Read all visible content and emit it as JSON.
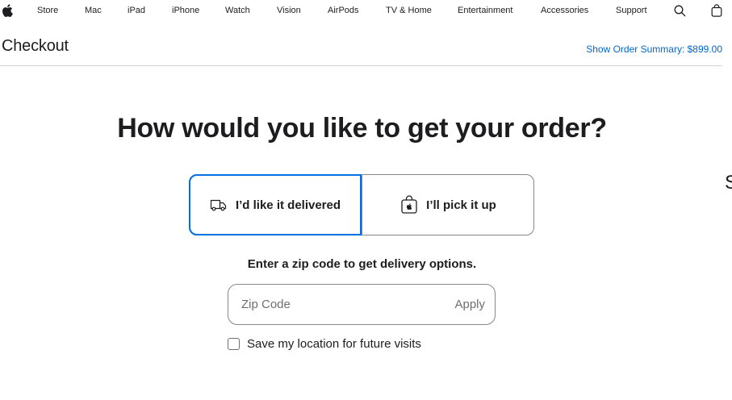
{
  "globalnav": {
    "items": [
      "Store",
      "Mac",
      "iPad",
      "iPhone",
      "Watch",
      "Vision",
      "AirPods",
      "TV & Home",
      "Entertainment",
      "Accessories",
      "Support"
    ]
  },
  "header": {
    "title": "Checkout",
    "order_summary": "Show Order Summary: $899.00"
  },
  "main": {
    "heading": "How would you like to get your order?",
    "options": {
      "delivered": "I’d like it delivered",
      "pickup": "I’ll pick it up"
    },
    "zip_prompt": "Enter a zip code to get delivery options.",
    "zip_placeholder": "Zip Code",
    "apply_label": "Apply",
    "save_location_label": "Save my location for future visits"
  },
  "edge_text": "S",
  "colors": {
    "accent": "#0071e3",
    "link": "#0066cc",
    "text": "#1d1d1f",
    "border": "#86868b"
  }
}
